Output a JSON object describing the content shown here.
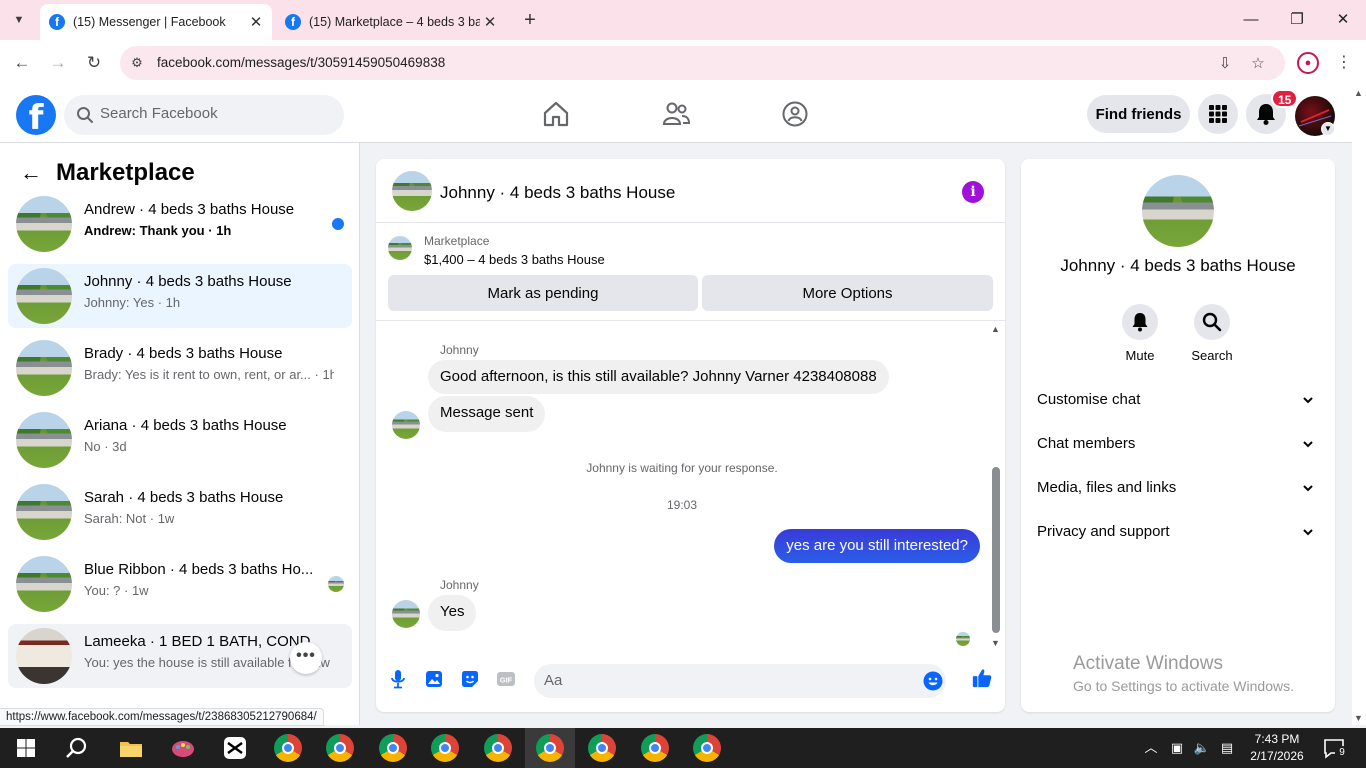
{
  "browser": {
    "tabs": [
      {
        "title": "(15) Messenger | Facebook",
        "active": true
      },
      {
        "title": "(15) Marketplace – 4 beds 3 bat",
        "active": false
      }
    ],
    "url": "facebook.com/messages/t/30591459050469838",
    "status_url": "https://www.facebook.com/messages/t/23868305212790684/"
  },
  "header": {
    "logo_letter": "f",
    "search_placeholder": "Search Facebook",
    "find_friends_label": "Find friends",
    "notification_count": "15"
  },
  "sidebar": {
    "title": "Marketplace",
    "conversations": [
      {
        "name": "Andrew · 4 beds 3 baths House",
        "preview": "Andrew: Thank you · 1h",
        "unread": true,
        "selected": false
      },
      {
        "name": "Johnny · 4 beds 3 baths House",
        "preview": "Johnny: Yes · 1h",
        "unread": false,
        "selected": true
      },
      {
        "name": "Brady · 4 beds 3 baths House",
        "preview": "Brady: Yes is it rent to own, rent, or ar... · 1h",
        "unread": false,
        "selected": false
      },
      {
        "name": "Ariana · 4 beds 3 baths House",
        "preview": "No · 3d",
        "unread": false,
        "selected": false
      },
      {
        "name": "Sarah · 4 beds 3 baths House",
        "preview": "Sarah: Not · 1w",
        "unread": false,
        "selected": false
      },
      {
        "name": "Blue Ribbon · 4 beds 3 baths Ho...",
        "preview": "You: ? · 1w",
        "unread": false,
        "selected": false
      },
      {
        "name": "Lameeka · 1 BED 1 BATH, COND",
        "preview": "You: yes the house is still available fo... 1w",
        "unread": false,
        "selected": false
      }
    ],
    "more_label": "•••"
  },
  "chat": {
    "title": "Johnny · 4 beds 3 baths House",
    "marketplace_label": "Marketplace",
    "listing": "$1,400 – 4 beds 3 baths House",
    "mark_pending_label": "Mark as pending",
    "more_options_label": "More Options",
    "messages": {
      "sender1": "Johnny",
      "in1": "Good afternoon, is this still available? Johnny Varner 4238408088",
      "in2": "Message sent",
      "system": "Johnny is waiting for your response.",
      "time": "19:03",
      "out1": "yes are you still interested?",
      "sender2": "Johnny",
      "in3": "Yes"
    },
    "composer_placeholder": "Aa",
    "gif_label": "GIF"
  },
  "info_panel": {
    "name": "Johnny · 4 beds 3 baths House",
    "mute_label": "Mute",
    "search_label": "Search",
    "sections": [
      "Customise chat",
      "Chat members",
      "Media, files and links",
      "Privacy and support"
    ]
  },
  "watermark": {
    "line1": "Activate Windows",
    "line2": "Go to Settings to activate Windows."
  },
  "taskbar": {
    "time": "7:43 PM",
    "date": "2/17/2026",
    "notification_count": "9"
  },
  "colors": {
    "facebook_blue": "#1877f2",
    "messenger_bubble": "#2a5ee8",
    "info_purple": "#a010d8",
    "badge_red": "#e41e3f"
  }
}
